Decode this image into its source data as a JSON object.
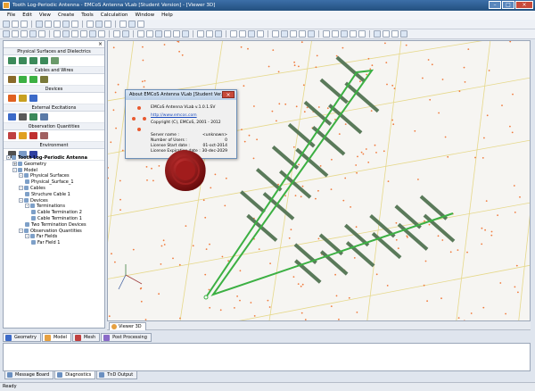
{
  "window": {
    "title": "Tooth Log-Periodic Antenna - EMCoS Antenna VLab [Student Version] - [Viewer 3D]"
  },
  "menu": [
    "File",
    "Edit",
    "View",
    "Create",
    "Tools",
    "Calculation",
    "Window",
    "Help"
  ],
  "left_panel": {
    "sections": [
      "Physical Surfaces and Dielectrics",
      "Cables and Wires",
      "Devices",
      "External Excitations",
      "Observation Quantities",
      "Environment"
    ],
    "tree": [
      {
        "label": "Tooth Log-Periodic Antenna",
        "level": 0,
        "toggle": "-"
      },
      {
        "label": "Geometry",
        "level": 1,
        "toggle": "+"
      },
      {
        "label": "Model",
        "level": 1,
        "toggle": "-"
      },
      {
        "label": "Physical Surfaces",
        "level": 2,
        "toggle": "-"
      },
      {
        "label": "Physical_Surface_1",
        "level": 3,
        "toggle": ""
      },
      {
        "label": "Cables",
        "level": 2,
        "toggle": "-"
      },
      {
        "label": "Structure Cable 1",
        "level": 3,
        "toggle": ""
      },
      {
        "label": "Devices",
        "level": 2,
        "toggle": "-"
      },
      {
        "label": "Terminations",
        "level": 3,
        "toggle": "-"
      },
      {
        "label": "Cable Termination 2",
        "level": 4,
        "toggle": ""
      },
      {
        "label": "Cable Termination 1",
        "level": 4,
        "toggle": ""
      },
      {
        "label": "Two Termination Devices",
        "level": 3,
        "toggle": ""
      },
      {
        "label": "Observation Quantities",
        "level": 2,
        "toggle": "-"
      },
      {
        "label": "Far Fields",
        "level": 3,
        "toggle": "-"
      },
      {
        "label": "Far Field 1",
        "level": 4,
        "toggle": ""
      }
    ]
  },
  "viewer_tab": "Viewer 3D",
  "bottom_tabs": [
    "Geometry",
    "Model",
    "Mesh",
    "Post Processing"
  ],
  "output_tabs": [
    "Message Board",
    "Diagnostics",
    "TnD Output"
  ],
  "status": "Ready",
  "about": {
    "title": "About EMCoS Antenna VLab [Student Ver...",
    "version": "EMCoS Antenna VLab v.1.0.1.SV",
    "url": "http://www.emcos.com",
    "copyright": "Copyright (C), EMCoS, 2001 - 2012",
    "rows": [
      {
        "label": "Server name :",
        "value": "<unknown>"
      },
      {
        "label": "Number of Users :",
        "value": "0"
      },
      {
        "label": "License Start date :",
        "value": "01-oct-2014"
      },
      {
        "label": "License Expiration date :",
        "value": "30-dec-2029"
      }
    ]
  },
  "colors": {
    "antenna": "#5a7a5a",
    "feed": "#3cb043",
    "grid": "#e6d88a",
    "points": "#f07a3c",
    "seal": "#8c1c1c"
  }
}
